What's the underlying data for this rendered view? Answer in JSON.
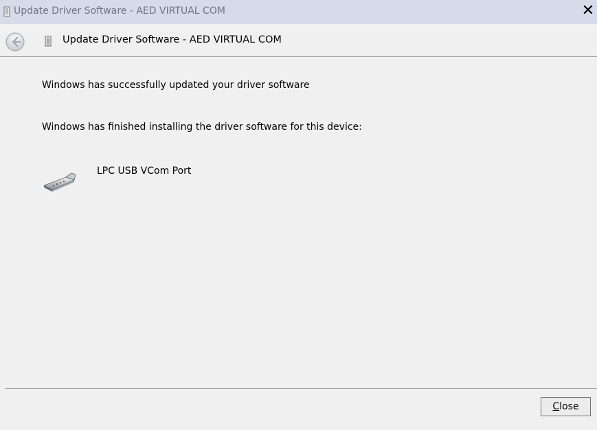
{
  "window": {
    "title": "Update Driver Software - AED VIRTUAL COM",
    "close_glyph": "✕"
  },
  "navbar": {
    "title": "Update Driver Software - AED VIRTUAL COM",
    "back_icon": "back-arrow-icon"
  },
  "content": {
    "success_heading": "Windows has successfully updated your driver software",
    "finished_text": "Windows has finished installing the driver software for this device:",
    "device_name": "LPC USB VCom Port",
    "device_icon": "serial-port-icon"
  },
  "footer": {
    "close_accel": "C",
    "close_rest": "lose"
  }
}
